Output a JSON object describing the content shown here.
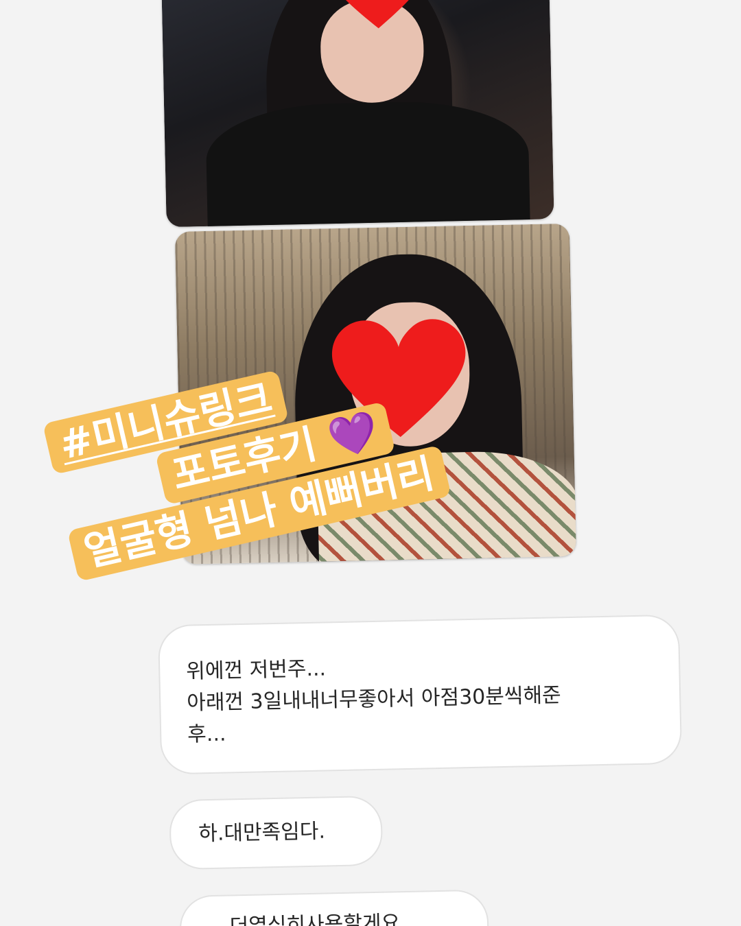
{
  "story": {
    "hashtag": "#미니슈링크",
    "caption_line1": "포토후기",
    "caption_emoji": "💜",
    "caption_line2": "얼굴형 넘나 예뻐버리"
  },
  "messages": [
    {
      "lines": [
        "위에껀 저번주...",
        "아래껀 3일내내너무좋아서 아점30분씩해준",
        "후..."
      ]
    },
    {
      "lines": [
        "하.대만족임다."
      ]
    },
    {
      "lines": [
        "...더열심히사용할게요"
      ]
    }
  ],
  "colors": {
    "tag_background": "#f6bf5a",
    "tag_text": "#ffffff",
    "heart": "#ee1c1c",
    "bubble_border": "#e2e2e2"
  }
}
